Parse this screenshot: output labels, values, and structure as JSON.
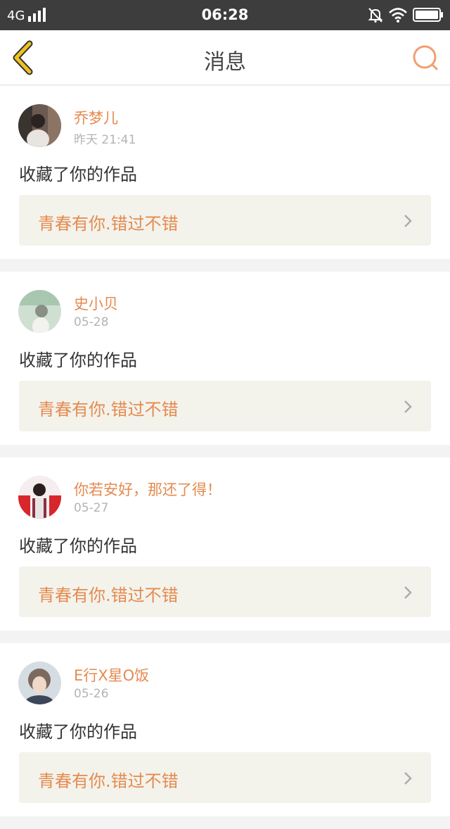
{
  "status_bar": {
    "network": "4G",
    "time": "06:28",
    "icons": [
      "signal-icon",
      "mute-icon",
      "wifi-icon",
      "battery-icon"
    ]
  },
  "header": {
    "title": "消息",
    "back_icon": "chevron-left-icon",
    "search_icon": "search-icon"
  },
  "colors": {
    "accent": "#e58a4f",
    "back_arrow": "#f0c020",
    "status_bar": "#3d3d3d",
    "card_link_bg": "#f3f3ec"
  },
  "messages": [
    {
      "username": "乔梦儿",
      "time": "昨天 21:41",
      "action": "收藏了你的作品",
      "work_title": "青春有你.错过不错"
    },
    {
      "username": "史小贝",
      "time": "05-28",
      "action": "收藏了你的作品",
      "work_title": "青春有你.错过不错"
    },
    {
      "username": "你若安好，那还了得！",
      "time": "05-27",
      "action": "收藏了你的作品",
      "work_title": "青春有你.错过不错"
    },
    {
      "username": "E行X星O饭",
      "time": "05-26",
      "action": "收藏了你的作品",
      "work_title": "青春有你.错过不错"
    }
  ]
}
